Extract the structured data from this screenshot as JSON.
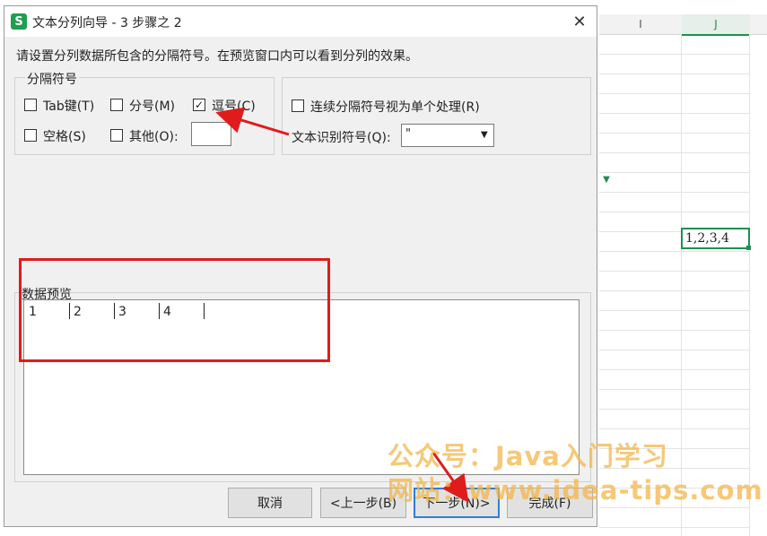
{
  "dialog": {
    "title": "文本分列向导 - 3 步骤之 2",
    "app_icon_letter": "S",
    "close_glyph": "✕",
    "instruction": "请设置分列数据所包含的分隔符号。在预览窗口内可以看到分列的效果。",
    "delimiters_group_label": "分隔符号",
    "delimiters": {
      "tab": {
        "label": "Tab键(T)",
        "checked": false
      },
      "semicolon": {
        "label": "分号(M)",
        "checked": false
      },
      "comma": {
        "label": "逗号(C)",
        "checked": true
      },
      "space": {
        "label": "空格(S)",
        "checked": false
      },
      "other": {
        "label": "其他(O):",
        "checked": false,
        "value": ""
      }
    },
    "consecutive": {
      "label": "连续分隔符号视为单个处理(R)",
      "checked": false
    },
    "text_qualifier": {
      "label": "文本识别符号(Q):",
      "value": "\""
    },
    "preview_label": "数据预览",
    "preview_cells": [
      "1",
      "2",
      "3",
      "4"
    ],
    "buttons": {
      "cancel": "取消",
      "back": "<上一步(B)",
      "next": "下一步(N)>",
      "finish": "完成(F)"
    }
  },
  "spreadsheet": {
    "column_i": "I",
    "column_j": "J",
    "selected_cell_value": "1,2,3,4"
  },
  "watermark": {
    "line1": "公众号：Java入门学习",
    "line2": "网站：www.idea-tips.com"
  },
  "colors": {
    "accent_green": "#1e9e4f",
    "highlight_red": "#e01b1b",
    "primary_border": "#2f7fd4",
    "watermark": "#f4b64a"
  }
}
